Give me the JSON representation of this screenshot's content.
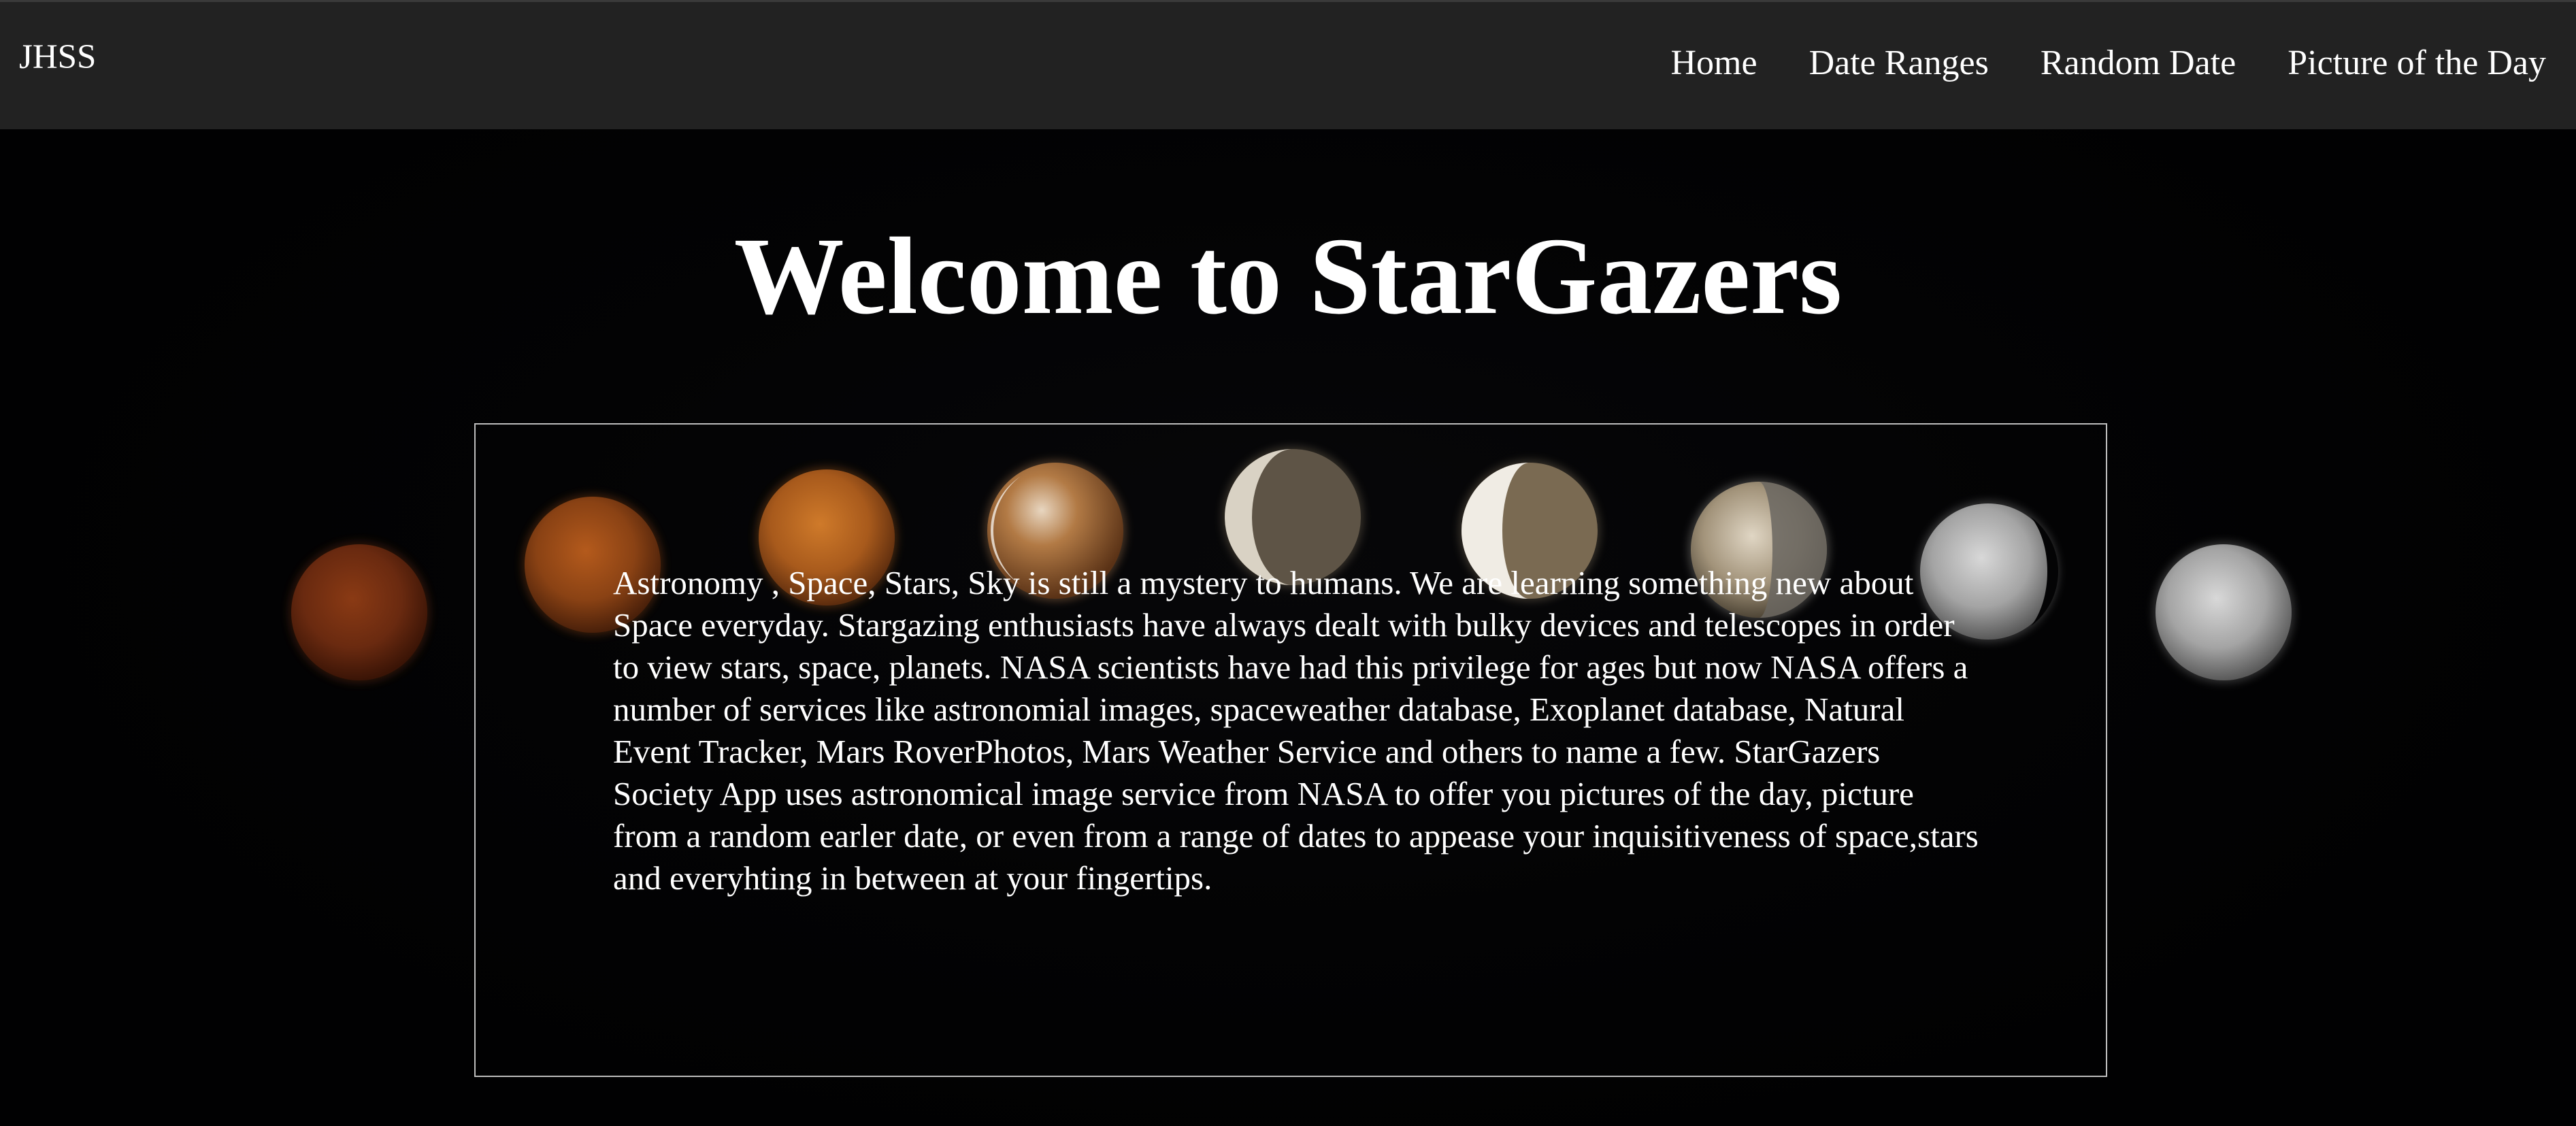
{
  "brand": "JHSS",
  "nav": {
    "items": [
      {
        "label": "Home"
      },
      {
        "label": "Date Ranges"
      },
      {
        "label": "Random Date"
      },
      {
        "label": "Picture of the Day"
      }
    ]
  },
  "hero": {
    "title": "Welcome to StarGazers"
  },
  "intro": {
    "text": "Astronomy , Space, Stars, Sky is still a mystery to humans. We are learning something new about Space everyday. Stargazing enthusiasts have always dealt with bulky devices and telescopes in order to view stars, space, planets. NASA scientists have had this privilege for ages but now NASA offers a number of services like astronomial images, spaceweather database, Exoplanet database, Natural Event Tracker, Mars RoverPhotos, Mars Weather Service and others to name a few. StarGazers Society App uses astronomical image service from NASA to offer you pictures of the day, picture from a random earler date, or even from a range of dates to appease your inquisitiveness of space,stars and everyhting in between at your fingertips."
  },
  "background_image": {
    "description_icon": "lunar-eclipse-sequence",
    "moon_phases": [
      {
        "name": "eclipse-moon-1",
        "color": "#7a3414"
      },
      {
        "name": "eclipse-moon-2",
        "color": "#9a4c18"
      },
      {
        "name": "eclipse-moon-3",
        "color": "#b0601c"
      },
      {
        "name": "eclipse-moon-4",
        "color": "#a7703a"
      },
      {
        "name": "eclipse-moon-5",
        "color": "#8b7d62"
      },
      {
        "name": "eclipse-moon-6",
        "color": "#8e7f66"
      },
      {
        "name": "eclipse-moon-7",
        "color": "#a6a39c"
      },
      {
        "name": "eclipse-moon-8",
        "color": "#a3a3a3"
      },
      {
        "name": "eclipse-moon-9",
        "color": "#9c9c9c"
      }
    ]
  },
  "colors": {
    "navbar_bg": "#222222",
    "page_bg": "#020203",
    "text": "#ffffff",
    "box_border": "#bdbdbd"
  }
}
